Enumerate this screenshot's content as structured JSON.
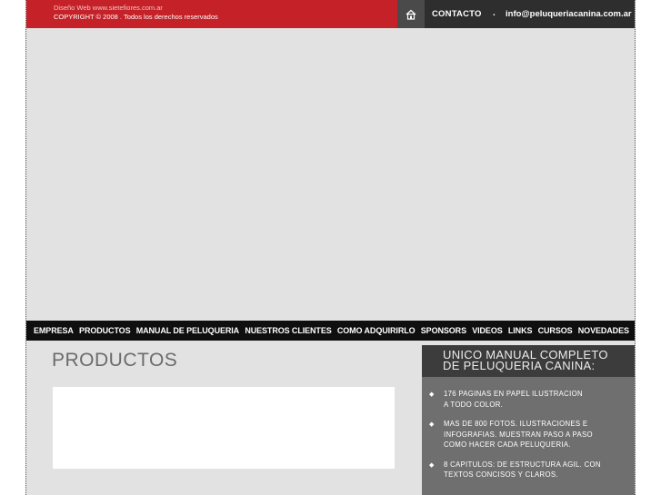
{
  "topbar": {
    "credit_web": "Diseño Web www.sietefiores.com.ar",
    "copyright": "COPYRIGHT © 2008 . Todos los derechos reservados",
    "contact_label": "CONTACTO",
    "contact_separator": ".",
    "email": "info@peluqueriacanina.com.ar"
  },
  "nav": {
    "items": [
      "EMPRESA",
      "PRODUCTOS",
      "MANUAL DE PELUQUERIA",
      "NUESTROS CLIENTES",
      "COMO ADQUIRIRLO",
      "SPONSORS",
      "VIDEOS",
      "LINKS",
      "CURSOS",
      "NOVEDADES"
    ]
  },
  "main": {
    "title": "PRODUCTOS"
  },
  "sidebar": {
    "heading_line1": "UNICO MANUAL COMPLETO",
    "heading_line2": "DE PELUQUERIA CANINA:",
    "bullets": [
      [
        "176 PAGINAS EN PAPEL ILUSTRACION",
        "A TODO COLOR."
      ],
      [
        "MAS DE 800 FOTOS. ILUSTRACIONES E",
        "INFOGRAFIAS. MUESTRAN PASO A PASO",
        "COMO HACER CADA PELUQUERIA."
      ],
      [
        "8 CAPITULOS: DE ESTRUCTURA AGIL. CON",
        "TEXTOS CONCISOS Y CLAROS."
      ]
    ]
  },
  "colors": {
    "red": "#c42128",
    "dark": "#2e2e2e",
    "nav_bg": "#0f0f0f",
    "page_bg": "#e2e2e2",
    "sidebar_bg": "#6f6f6f"
  },
  "icons": {
    "home": "home-icon",
    "bullet": "diamond-bullet-icon"
  }
}
